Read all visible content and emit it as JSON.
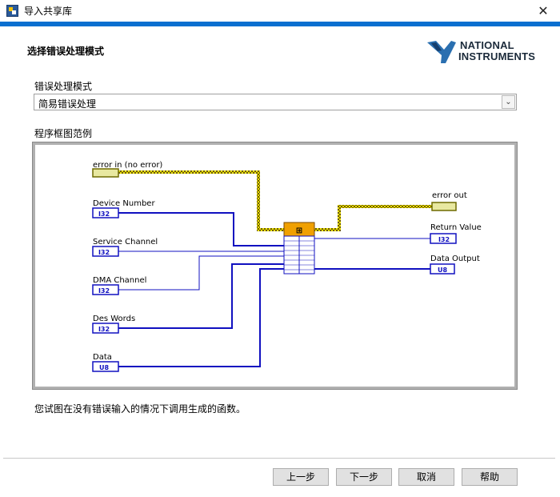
{
  "window": {
    "title": "导入共享库",
    "close_symbol": "✕"
  },
  "header": {
    "title": "选择错误处理模式",
    "logo_line1": "NATIONAL",
    "logo_line2": "INSTRUMENTS"
  },
  "error_mode": {
    "label": "错误处理模式",
    "selected": "简易错误处理"
  },
  "diagram": {
    "label": "程序框图范例",
    "inputs": [
      {
        "name": "error in (no error)",
        "type": ""
      },
      {
        "name": "Device Number",
        "type": "I32"
      },
      {
        "name": "Service Channel",
        "type": "I32"
      },
      {
        "name": "DMA Channel",
        "type": "I32"
      },
      {
        "name": "Des Words",
        "type": "I32"
      },
      {
        "name": "Data",
        "type": "U8"
      }
    ],
    "outputs": [
      {
        "name": "error out",
        "type": ""
      },
      {
        "name": "Return Value",
        "type": "I32"
      },
      {
        "name": "Data Output",
        "type": "U8"
      }
    ]
  },
  "note": "您试图在没有错误输入的情况下调用生成的函数。",
  "buttons": {
    "back": "上一步",
    "next": "下一步",
    "cancel": "取消",
    "help": "帮助"
  },
  "colors": {
    "accent_bar": "#0a6fd0",
    "wire_blue": "#1010c0",
    "wire_error": "#c8c800",
    "node_orange": "#f0a000"
  }
}
